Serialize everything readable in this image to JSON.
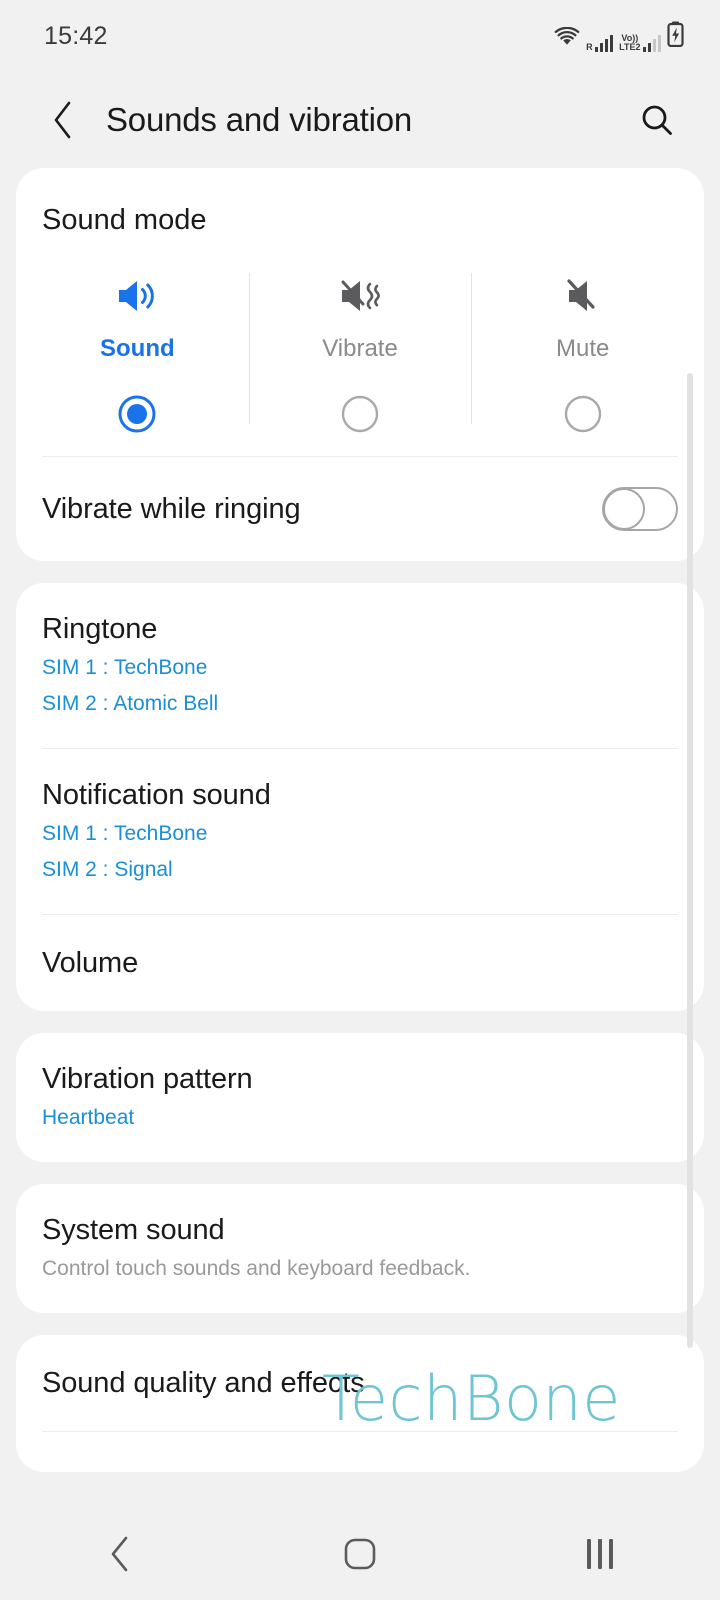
{
  "status_bar": {
    "time": "15:42",
    "icons": [
      "wifi-icon",
      "roaming-signal-icon",
      "volte-lte2-signal-icon",
      "battery-charging-icon"
    ],
    "roaming_label": "R",
    "volte_label": "Vo))",
    "network_label": "LTE2"
  },
  "app_bar": {
    "back_icon": "back-chevron-icon",
    "title": "Sounds and vibration",
    "search_icon": "search-icon"
  },
  "sound_mode": {
    "title": "Sound mode",
    "options": [
      {
        "label": "Sound",
        "icon": "speaker-on-icon",
        "selected": true
      },
      {
        "label": "Vibrate",
        "icon": "speaker-vibrate-icon",
        "selected": false
      },
      {
        "label": "Mute",
        "icon": "speaker-mute-icon",
        "selected": false
      }
    ]
  },
  "vibrate_while_ringing": {
    "title": "Vibrate while ringing",
    "toggle_state": "off"
  },
  "ringtone": {
    "title": "Ringtone",
    "sim1": "SIM 1 : TechBone",
    "sim2": "SIM 2 : Atomic Bell"
  },
  "notification_sound": {
    "title": "Notification sound",
    "sim1": "SIM 1 : TechBone",
    "sim2": "SIM 2 : Signal"
  },
  "volume": {
    "title": "Volume"
  },
  "vibration_pattern": {
    "title": "Vibration pattern",
    "value": "Heartbeat"
  },
  "system_sound": {
    "title": "System sound",
    "description": "Control touch sounds and keyboard feedback."
  },
  "sound_quality": {
    "title": "Sound quality and effects"
  },
  "watermark": {
    "text": "TechBone",
    "color": "#6fc5d3"
  },
  "nav_bar": {
    "back_icon": "nav-back-icon",
    "home_icon": "nav-home-icon",
    "recents_icon": "nav-recents-icon"
  },
  "colors": {
    "accent_blue": "#1a73e8",
    "link_blue": "#1a8fd6",
    "page_background": "#f1f1f1",
    "card_background": "#ffffff"
  }
}
